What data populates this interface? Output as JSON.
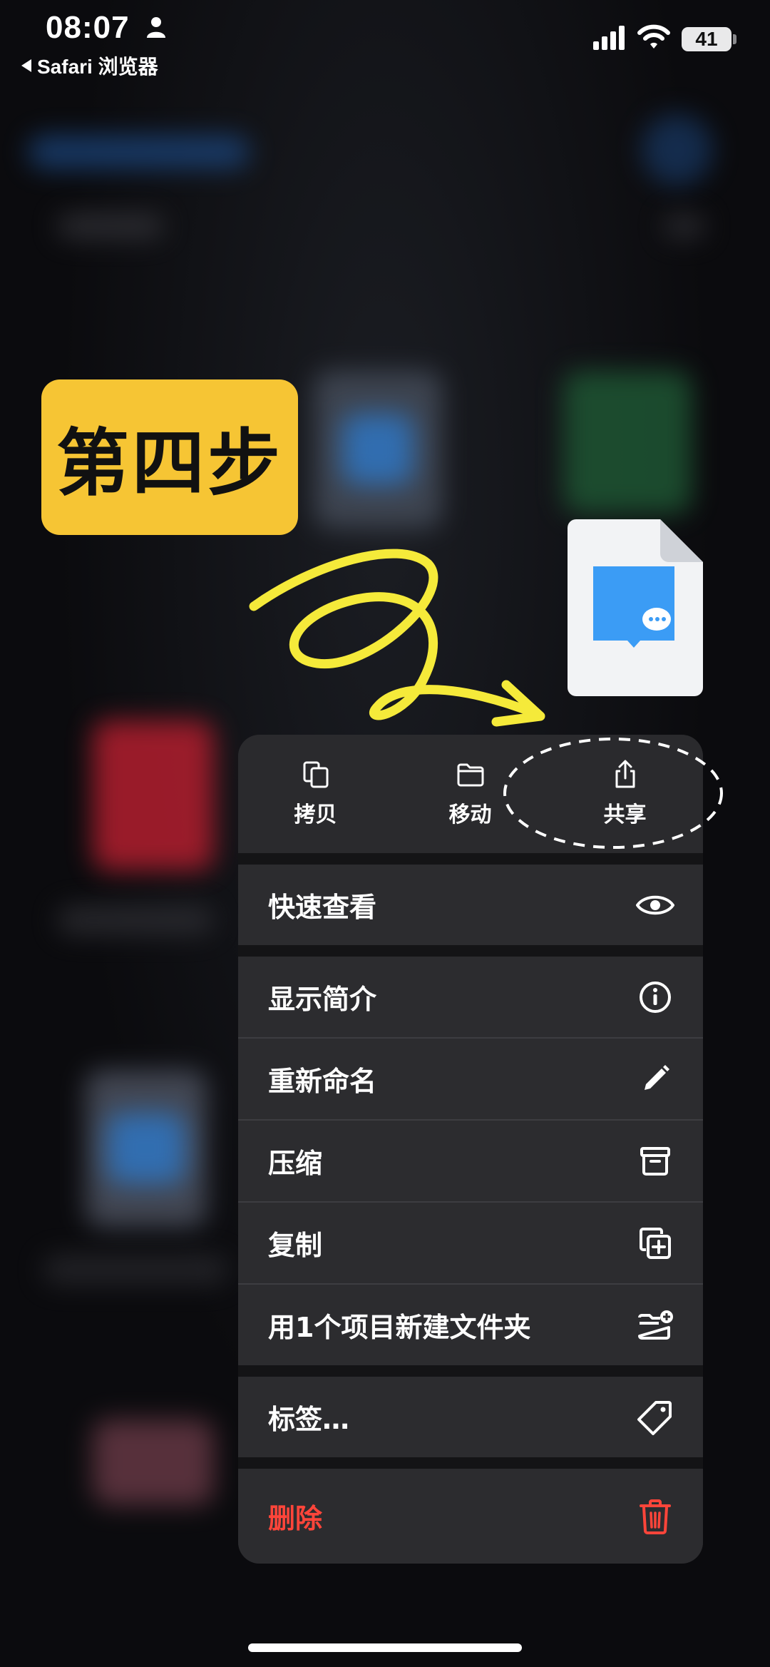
{
  "status_bar": {
    "time": "08:07",
    "back_app": "Safari 浏览器",
    "battery_level": "41",
    "icons": [
      "person-icon",
      "cellular-signal-icon",
      "wifi-icon",
      "battery-icon"
    ]
  },
  "annotation": {
    "step_label": "第四步",
    "colors": {
      "badge": "#f6c534",
      "scribble": "#f5ea3a"
    }
  },
  "file": {
    "icon": "wechat-document-icon",
    "accent": "#3b9cf5"
  },
  "menu": {
    "top_actions": [
      {
        "label": "拷贝",
        "icon": "copy-icon"
      },
      {
        "label": "移动",
        "icon": "folder-icon"
      },
      {
        "label": "共享",
        "icon": "share-icon"
      }
    ],
    "items": [
      {
        "label": "快速查看",
        "icon": "eye-icon"
      },
      {
        "label": "显示简介",
        "icon": "info-icon"
      },
      {
        "label": "重新命名",
        "icon": "pencil-icon"
      },
      {
        "label": "压缩",
        "icon": "archive-box-icon"
      },
      {
        "label": "复制",
        "icon": "duplicate-icon"
      },
      {
        "label": "用1个项目新建文件夹",
        "icon": "folder-plus-icon"
      },
      {
        "label": "标签…",
        "icon": "tag-icon"
      },
      {
        "label": "删除",
        "icon": "trash-icon",
        "color": "#ff453a"
      }
    ]
  }
}
